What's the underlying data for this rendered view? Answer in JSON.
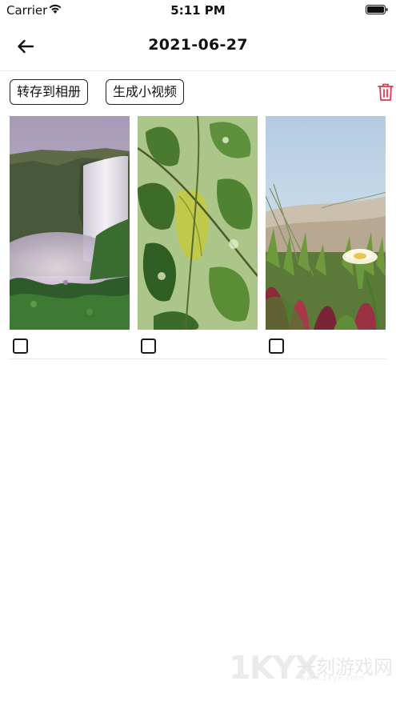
{
  "status_bar": {
    "carrier": "Carrier",
    "time": "5:11 PM",
    "icons": [
      "wifi-icon",
      "battery-icon"
    ]
  },
  "nav": {
    "title": "2021-06-27",
    "back_icon": "arrow-left-icon"
  },
  "actions": {
    "save_to_album_label": "转存到相册",
    "make_video_label": "生成小视频",
    "delete_icon": "trash-icon",
    "delete_color": "#e8364a"
  },
  "photos": [
    {
      "subject": "waterfall",
      "checked": false
    },
    {
      "subject": "leaves",
      "checked": false
    },
    {
      "subject": "flower",
      "checked": false
    }
  ],
  "watermark": {
    "logo": "1KYX",
    "name": "一刻游戏网",
    "url": "www.1kyx.com"
  }
}
